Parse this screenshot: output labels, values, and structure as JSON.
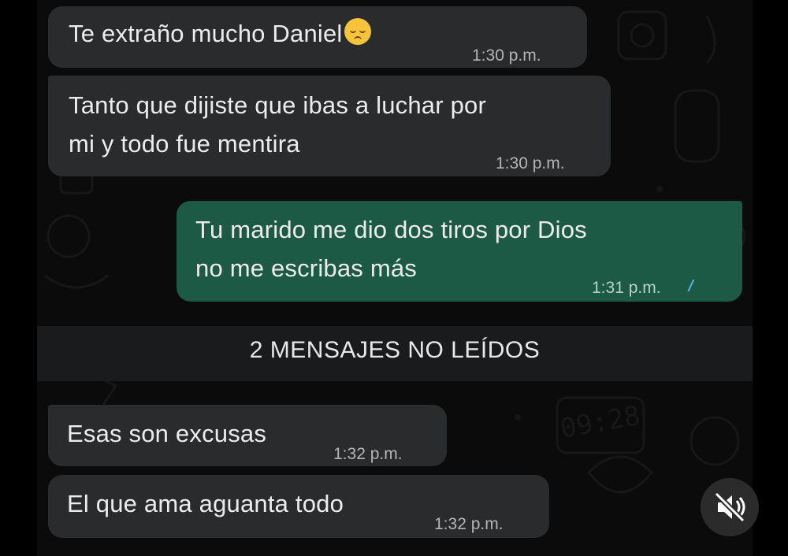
{
  "messages": [
    {
      "direction": "in",
      "text_lines": [
        "Te extraño mucho Daniel"
      ],
      "emoji": "pensive-face",
      "time": "1:30 p.m."
    },
    {
      "direction": "in",
      "text_lines": [
        "Tanto que dijiste que ibas a luchar por",
        "mi y todo fue mentira"
      ],
      "time": "1:30 p.m."
    },
    {
      "direction": "out",
      "text_lines": [
        "Tu marido me dio dos tiros por Dios",
        "no me escribas más"
      ],
      "time": "1:31 p.m.",
      "status": "read"
    },
    {
      "direction": "in",
      "text_lines": [
        "Esas son excusas"
      ],
      "time": "1:32 p.m."
    },
    {
      "direction": "in",
      "text_lines": [
        "El que ama aguanta todo"
      ],
      "time": "1:32 p.m."
    }
  ],
  "unread_divider": "2 MENSAJES NO LEÍDOS",
  "colors": {
    "incoming_bubble": "#2a2b2d",
    "outgoing_bubble": "#1d5a46",
    "read_ticks": "#56b7f5",
    "background": "#0b0b0b"
  },
  "overlay": {
    "mute_button_icon": "speaker-muted-icon"
  }
}
